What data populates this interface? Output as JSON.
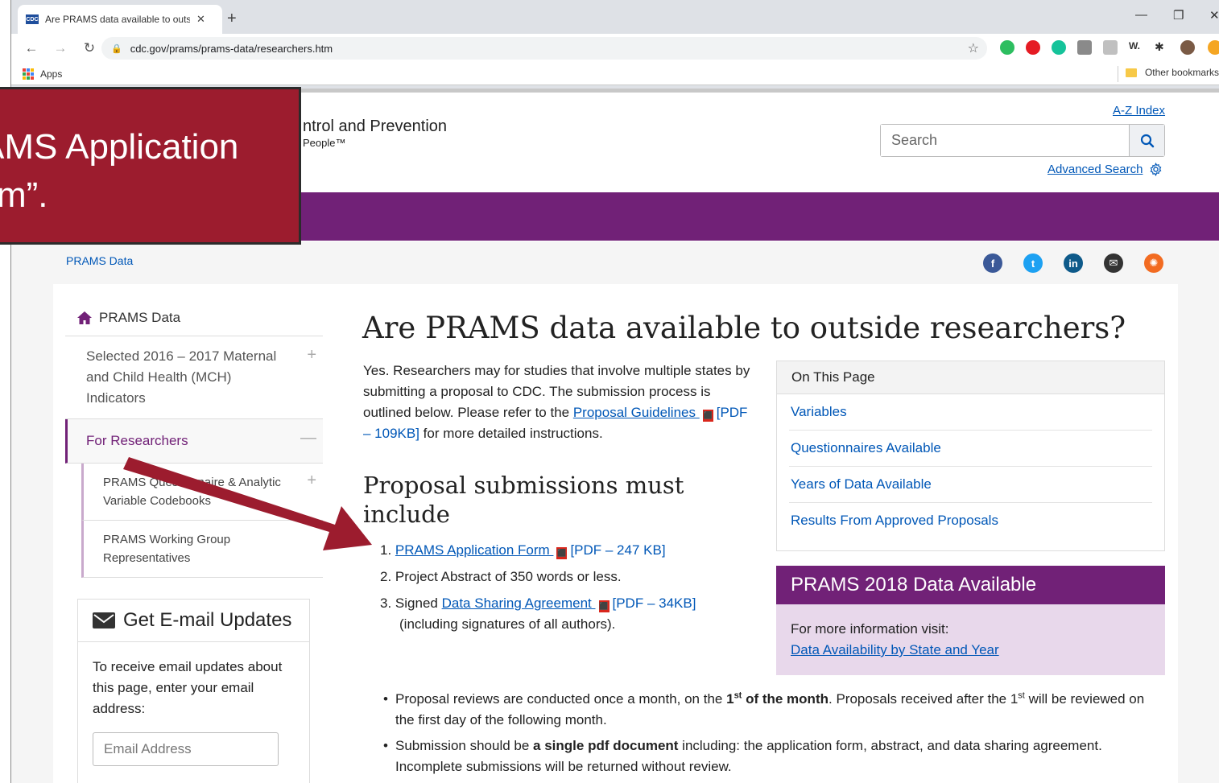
{
  "browser": {
    "tab_title": "Are PRAMS data available to outs",
    "favicon_text": "CDC",
    "url": "cdc.gov/prams/prams-data/researchers.htm",
    "apps_label": "Apps",
    "other_bookmarks": "Other bookmarks"
  },
  "header": {
    "brand": "ntrol and Prevention",
    "tagline": "People™",
    "az_index": "A-Z Index",
    "search_placeholder": "Search",
    "advanced_search": "Advanced Search"
  },
  "callout": {
    "line1": "AMS Application",
    "line2": "m”."
  },
  "breadcrumb": "PRAMS Data",
  "social": [
    "facebook-icon",
    "twitter-icon",
    "linkedin-icon",
    "email-icon",
    "syndicate-icon"
  ],
  "leftnav": {
    "home": "PRAMS Data",
    "item1": "Selected 2016 – 2017 Maternal and Child Health (MCH) Indicators",
    "active": "For Researchers",
    "sub1": "PRAMS Questionnaire & Analytic Variable Codebooks",
    "sub2": "PRAMS Working Group Representatives"
  },
  "email": {
    "title": "Get E-mail Updates",
    "text": "To receive email updates about this page, enter your email address:",
    "placeholder": "Email Address"
  },
  "main": {
    "title": "Are PRAMS data available to outside researchers?",
    "intro_before": "Yes. Researchers may for studies that involve multiple states by submitting a proposal to CDC. The submission process is outlined below. Please refer to the ",
    "intro_link": "Proposal Guidelines ",
    "intro_pdf": "[PDF – 109KB]",
    "intro_after": " for more detailed instructions.",
    "subtitle": "Proposal submissions must include",
    "list": [
      {
        "num": "1.",
        "link": "PRAMS Application Form ",
        "pdf": "[PDF – 247 KB]"
      },
      {
        "num": "2.",
        "text": "Project Abstract of 350 words or less."
      },
      {
        "num": "3.",
        "prefix": "Signed ",
        "link": "Data Sharing Agreement ",
        "pdf": "[PDF – 34KB]",
        "cont": "(including signatures of all authors)."
      }
    ]
  },
  "on_this_page": {
    "title": "On This Page",
    "items": [
      "Variables",
      "Questionnaires Available",
      "Years of Data Available",
      "Results From Approved Proposals"
    ]
  },
  "avail": {
    "title": "PRAMS 2018 Data Available",
    "label": "For more information visit:",
    "link": "Data Availability by State and Year"
  },
  "bullets": {
    "b1_a": "Proposal reviews are conducted once a month, on the ",
    "b1_num": "1",
    "b1_sup": "st",
    "b1_bold": " of the month",
    "b1_b": ".  Proposals received after the 1",
    "b1_sup2": "st",
    "b1_c": " will be reviewed on the first day of the following month.",
    "b2_a": "Submission should be ",
    "b2_bold": "a single pdf document",
    "b2_b": " including: the application form, abstract, and data sharing agreement. Incomplete submissions will be returned without review."
  },
  "colors": {
    "purple": "#712177",
    "callout_red": "#9c1c2e",
    "link_blue": "#0057b7"
  }
}
